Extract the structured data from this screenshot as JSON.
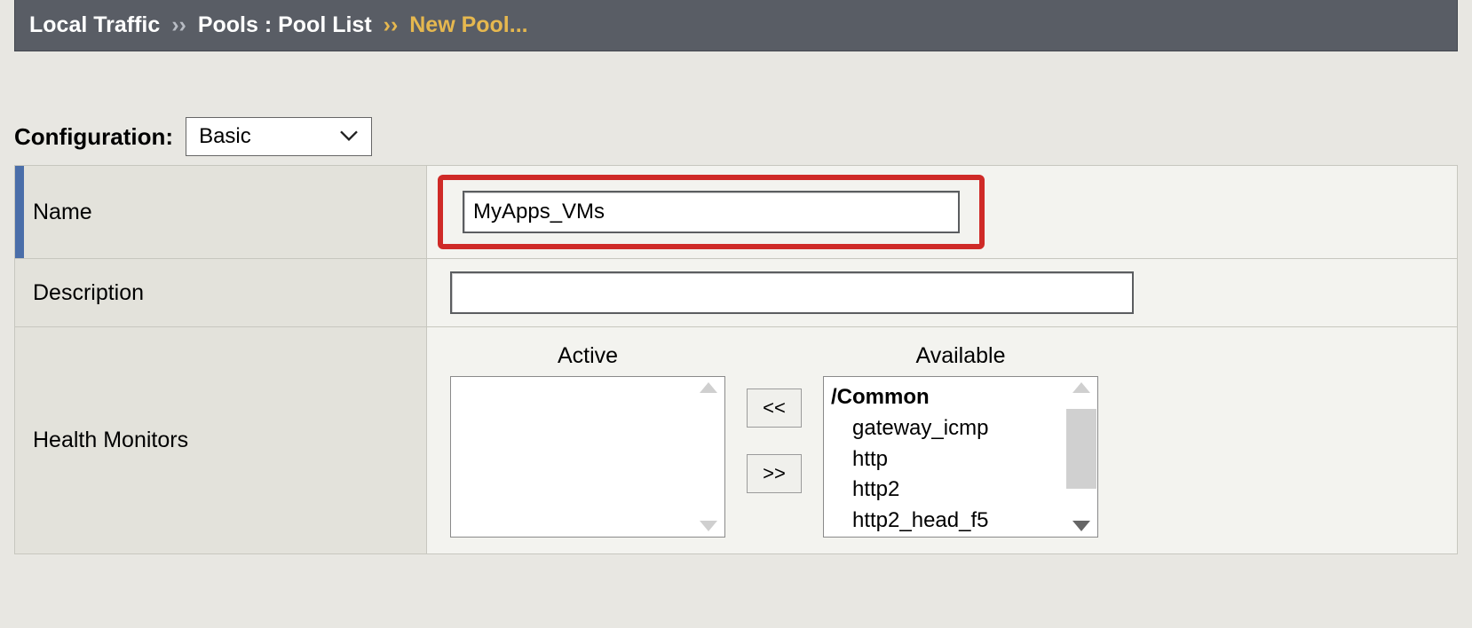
{
  "breadcrumb": {
    "level1": "Local Traffic",
    "level2": "Pools : Pool List",
    "current": "New Pool...",
    "sep": "››"
  },
  "configuration": {
    "label": "Configuration:",
    "selected": "Basic"
  },
  "form": {
    "name": {
      "label": "Name",
      "value": "MyApps_VMs"
    },
    "description": {
      "label": "Description",
      "value": ""
    },
    "health_monitors": {
      "label": "Health Monitors",
      "active_header": "Active",
      "available_header": "Available",
      "move_left": "<<",
      "move_right": ">>",
      "active_items": [],
      "available_group": "/Common",
      "available_items": [
        "gateway_icmp",
        "http",
        "http2",
        "http2_head_f5"
      ]
    }
  }
}
